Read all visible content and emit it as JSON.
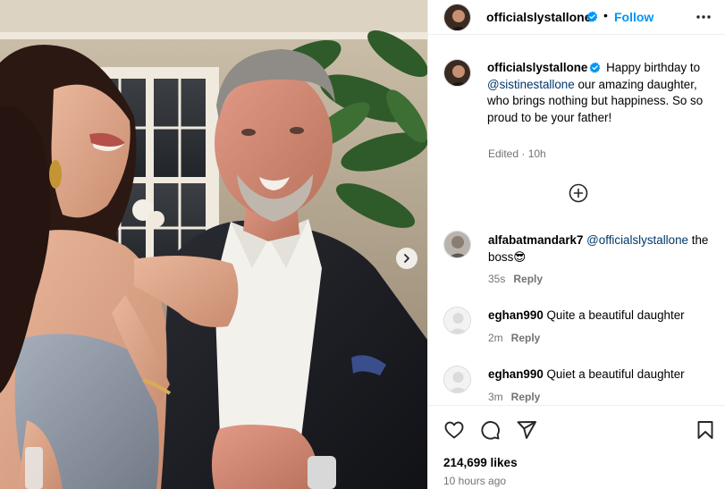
{
  "post": {
    "author": "officialslystallone",
    "follow_label": "Follow",
    "separator": "•"
  },
  "caption": {
    "user": "officialslystallone",
    "text_before": " Happy birthday to ",
    "mention": "@sistinestallone",
    "text_after": " our amazing daughter, who brings nothing but happiness. So so proud to be your father!",
    "edited_label": "Edited",
    "meta_separator": " · ",
    "time": "10h"
  },
  "comments": [
    {
      "user": "alfabatmandark7",
      "mention": "@officialslystallone",
      "text": " the boss",
      "emoji": "😎",
      "time": "35s",
      "reply_label": "Reply"
    },
    {
      "user": "eghan990",
      "text": " Quite a beautiful daughter",
      "time": "2m",
      "reply_label": "Reply"
    },
    {
      "user": "eghan990",
      "text": " Quiet a beautiful daughter",
      "time": "3m",
      "reply_label": "Reply"
    }
  ],
  "footer": {
    "likes": "214,699 likes",
    "time": "10 hours ago"
  },
  "icons": {
    "verified": "verified-badge-icon",
    "more": "more-options-icon",
    "load_more": "plus-circle-icon",
    "next": "chevron-right-icon",
    "like": "heart-icon",
    "comment": "comment-bubble-icon",
    "share": "paper-plane-icon",
    "save": "bookmark-icon"
  },
  "colors": {
    "link": "#0095f6",
    "mention": "#00376b",
    "muted": "#737373",
    "verified": "#0095f6"
  }
}
